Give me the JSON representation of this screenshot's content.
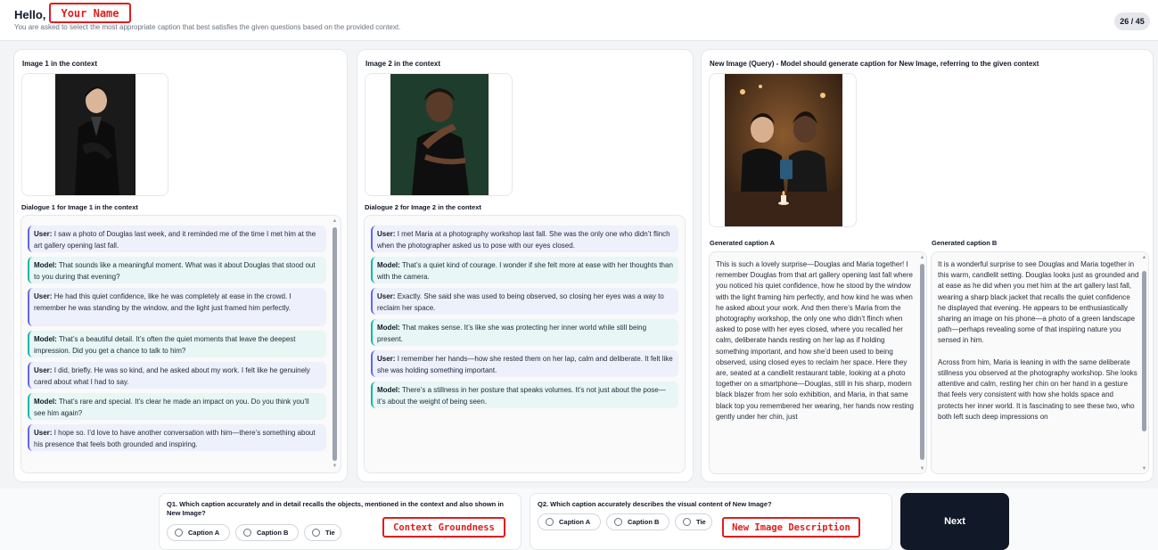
{
  "header": {
    "greeting": "Hello,",
    "name_tag": "Your Name",
    "instructions": "You are asked to select the most appropriate caption that best satisfies the given questions based on the provided context.",
    "progress": "26 / 45"
  },
  "context1": {
    "title": "Image 1 in the context",
    "dialogue_title": "Dialogue 1 for Image 1 in the context",
    "messages": [
      {
        "role": "User:",
        "text": "I saw a photo of Douglas last week, and it reminded me of the time I met him at the art gallery opening last fall."
      },
      {
        "role": "Model:",
        "text": "That sounds like a meaningful moment. What was it about Douglas that stood out to you during that evening?"
      },
      {
        "role": "User:",
        "text": "He had this quiet confidence, like he was completely at ease in the crowd. I remember he was standing by the window, and the light just framed him perfectly."
      },
      {
        "role": "Model:",
        "text": "That’s a beautiful detail. It’s often the quiet moments that leave the deepest impression. Did you get a chance to talk to him?"
      },
      {
        "role": "User:",
        "text": "I did, briefly. He was so kind, and he asked about my work. I felt like he genuinely cared about what I had to say."
      },
      {
        "role": "Model:",
        "text": "That’s rare and special. It’s clear he made an impact on you. Do you think you’ll see him again?"
      },
      {
        "role": "User:",
        "text": "I hope so. I’d love to have another conversation with him—there’s something about his presence that feels both grounded and inspiring."
      }
    ]
  },
  "context2": {
    "title": "Image 2 in the context",
    "dialogue_title": "Dialogue 2 for Image 2 in the context",
    "messages": [
      {
        "role": "User:",
        "text": "I met Maria at a photography workshop last fall. She was the only one who didn’t flinch when the photographer asked us to pose with our eyes closed."
      },
      {
        "role": "Model:",
        "text": "That’s a quiet kind of courage. I wonder if she felt more at ease with her thoughts than with the camera."
      },
      {
        "role": "User:",
        "text": "Exactly. She said she was used to being observed, so closing her eyes was a way to reclaim her space."
      },
      {
        "role": "Model:",
        "text": "That makes sense. It’s like she was protecting her inner world while still being present."
      },
      {
        "role": "User:",
        "text": "I remember her hands—how she rested them on her lap, calm and deliberate. It felt like she was holding something important."
      },
      {
        "role": "Model:",
        "text": "There’s a stillness in her posture that speaks volumes. It’s not just about the pose—it’s about the weight of being seen."
      }
    ]
  },
  "query": {
    "title": "New Image (Query) - Model should generate caption for New Image, referring to the given context",
    "caption_a_title": "Generated caption A",
    "caption_b_title": "Generated caption B",
    "caption_a": "This is such a lovely surprise—Douglas and Maria together! I remember Douglas from that art gallery opening last fall where you noticed his quiet confidence, how he stood by the window with the light framing him perfectly, and how kind he was when he asked about your work. And then there’s Maria from the photography workshop, the only one who didn’t flinch when asked to pose with her eyes closed, where you recalled her calm, deliberate hands resting on her lap as if holding something important, and how she’d been used to being observed, using closed eyes to reclaim her space. Here they are, seated at a candlelit restaurant table, looking at a photo together on a smartphone—Douglas, still in his sharp, modern black blazer from her solo exhibition, and Maria, in that same black top you remembered her wearing, her hands now resting gently under her chin, just",
    "caption_b": "It is a wonderful surprise to see Douglas and Maria together in this warm, candlelit setting. Douglas looks just as grounded and at ease as he did when you met him at the art gallery last fall, wearing a sharp black jacket that recalls the quiet confidence he displayed that evening. He appears to be enthusiastically sharing an image on his phone—a photo of a green landscape path—perhaps revealing some of that inspiring nature you sensed in him.\n\nAcross from him, Maria is leaning in with the same deliberate stillness you observed at the photography workshop. She looks attentive and calm, resting her chin on her hand in a gesture that feels very consistent with how she holds space and protects her inner world. It is fascinating to see these two, who both left such deep impressions on"
  },
  "questions": {
    "q1": "Q1. Which caption accurately and in detail recalls the objects, mentioned in the context and also shown in New Image?",
    "q2": "Q2. Which caption accurately describes the visual content of New Image?",
    "options": [
      "Caption A",
      "Caption B",
      "Tie"
    ],
    "tag1": "Context Groundness",
    "tag2": "New Image Description"
  },
  "next_label": "Next",
  "colors": {
    "accent_user": "#6366f1",
    "accent_model": "#14b8a6",
    "annotation_red": "#e11d1d",
    "next_bg": "#111827"
  }
}
